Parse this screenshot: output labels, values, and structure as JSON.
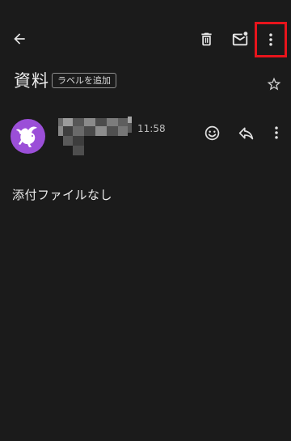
{
  "toolbar": {
    "back_icon": "arrow-left-icon",
    "delete_icon": "trash-icon",
    "mark_unread_icon": "mail-unread-icon",
    "more_icon": "more-vert-icon"
  },
  "subject": {
    "title": "資料",
    "label_chip": "ラベルを追加",
    "star_icon": "star-outline-icon"
  },
  "message": {
    "time": "11:58",
    "avatar_icon": "pegasus-icon",
    "react_icon": "emoji-icon",
    "reply_icon": "reply-icon",
    "more_icon": "more-vert-icon"
  },
  "body": {
    "text": "添付ファイルなし"
  },
  "colors": {
    "background": "#1b1b1b",
    "avatar": "#9b4fd8",
    "highlight": "#e8141c"
  }
}
